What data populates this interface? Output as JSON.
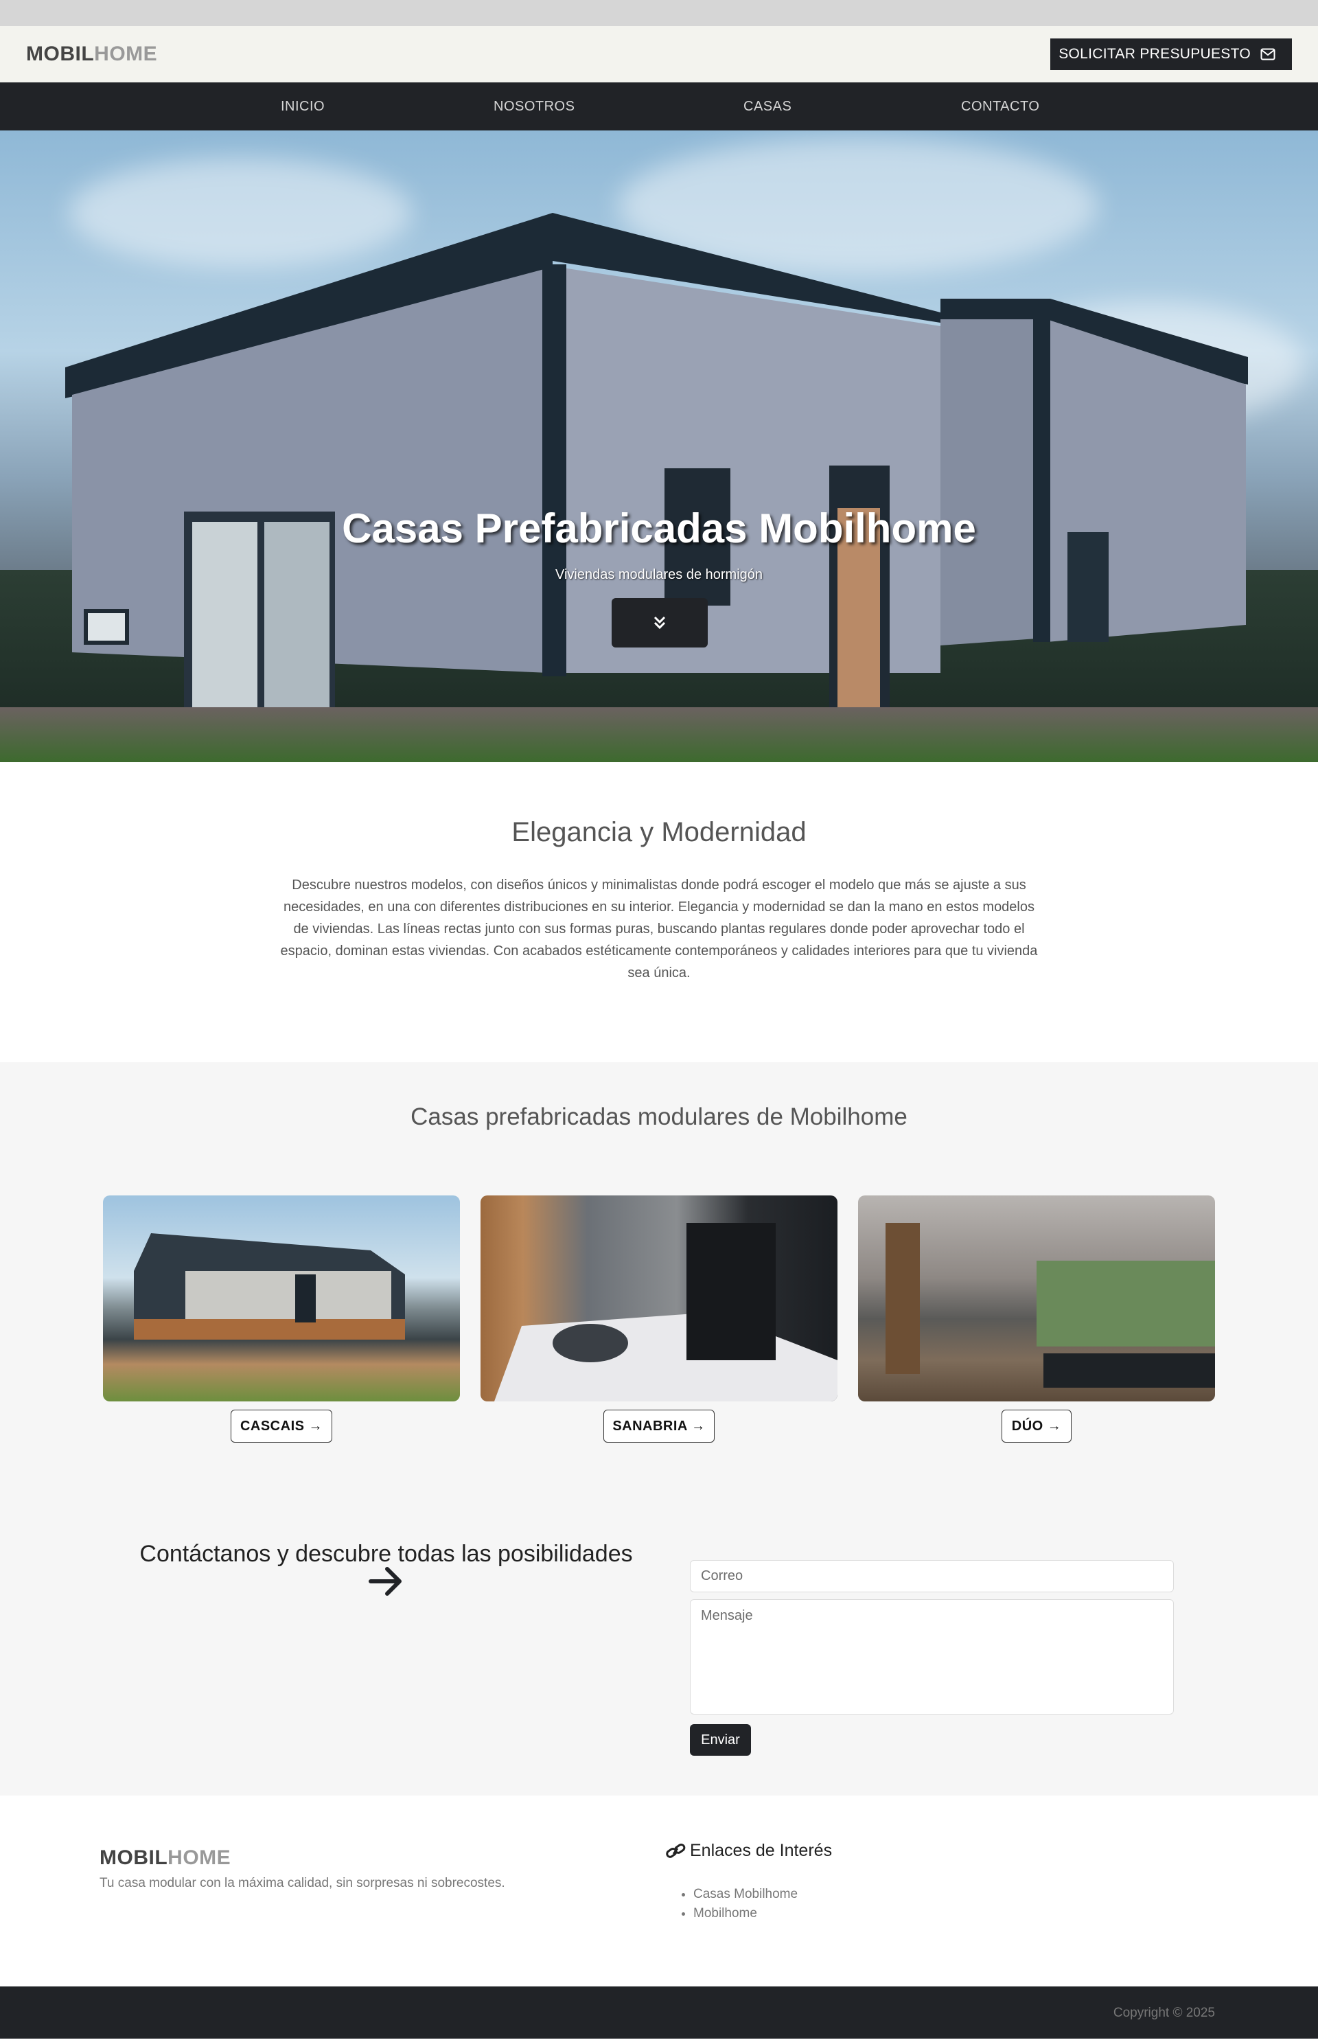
{
  "brand": {
    "part1": "MOBIL",
    "part2": "HOME"
  },
  "header": {
    "quote_label": "SOLICITAR PRESUPUESTO"
  },
  "nav": [
    "INICIO",
    "NOSOTROS",
    "CASAS",
    "CONTACTO"
  ],
  "hero": {
    "title": "Casas Prefabricadas Mobilhome",
    "subtitle": "Viviendas modulares de hormigón"
  },
  "elegance": {
    "title": "Elegancia y Modernidad",
    "text": "Descubre nuestros modelos, con diseños únicos y minimalistas donde podrá escoger el modelo que más se ajuste a sus necesidades, en una con diferentes distribuciones en su interior. Elegancia y modernidad se dan la mano en estos modelos de viviendas. Las líneas rectas junto con sus formas puras, buscando plantas regulares donde poder aprovechar todo el espacio, dominan estas viviendas. Con acabados estéticamente contemporáneos y calidades interiores para que tu vivienda sea única."
  },
  "models": {
    "title": "Casas prefabricadas modulares de Mobilhome",
    "items": [
      {
        "label": "CASCAIS →"
      },
      {
        "label": "SANABRIA →"
      },
      {
        "label": "DÚO →"
      }
    ]
  },
  "contact": {
    "title": "Contáctanos y descubre todas las posibilidades",
    "email_placeholder": "Correo",
    "message_placeholder": "Mensaje",
    "send_label": "Enviar"
  },
  "footer": {
    "tagline": "Tu casa modular con la máxima calidad, sin sorpresas ni sobrecostes.",
    "links_title": "Enlaces de Interés",
    "links": [
      "Casas Mobilhome",
      "Mobilhome"
    ],
    "copyright": "Copyright © 2025"
  },
  "colors": {
    "dark": "#212327",
    "header_bg": "#f3f3ee",
    "section_bg": "#f6f6f6"
  }
}
